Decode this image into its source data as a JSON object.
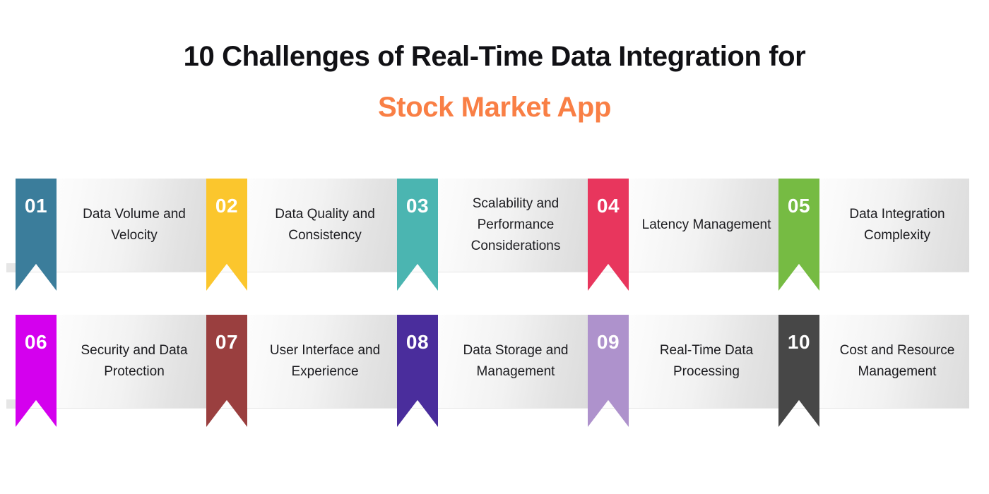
{
  "title": {
    "line1": "10 Challenges of Real-Time Data Integration for",
    "line2": "Stock Market App",
    "accent_color": "#f97f45",
    "primary_color": "#111115"
  },
  "cards": [
    {
      "number": "01",
      "label": "Data Volume and Velocity",
      "color": "#3b7d9b"
    },
    {
      "number": "02",
      "label": "Data Quality and Consistency",
      "color": "#fbc62d"
    },
    {
      "number": "03",
      "label": "Scalability and Performance Considerations",
      "color": "#4bb5b1"
    },
    {
      "number": "04",
      "label": "Latency Management",
      "color": "#e8365d"
    },
    {
      "number": "05",
      "label": "Data Integration Complexity",
      "color": "#76bb43"
    },
    {
      "number": "06",
      "label": "Security and Data Protection",
      "color": "#d400ee"
    },
    {
      "number": "07",
      "label": "User Interface and Experience",
      "color": "#9a3f3f"
    },
    {
      "number": "08",
      "label": "Data Storage and Management",
      "color": "#4a2d9c"
    },
    {
      "number": "09",
      "label": "Real-Time Data Processing",
      "color": "#ae92cc"
    },
    {
      "number": "10",
      "label": "Cost and Resource Management",
      "color": "#474747"
    }
  ],
  "layout": {
    "columns": 5,
    "rows": 2,
    "column_pitch": 270,
    "row_pitch": 193
  }
}
